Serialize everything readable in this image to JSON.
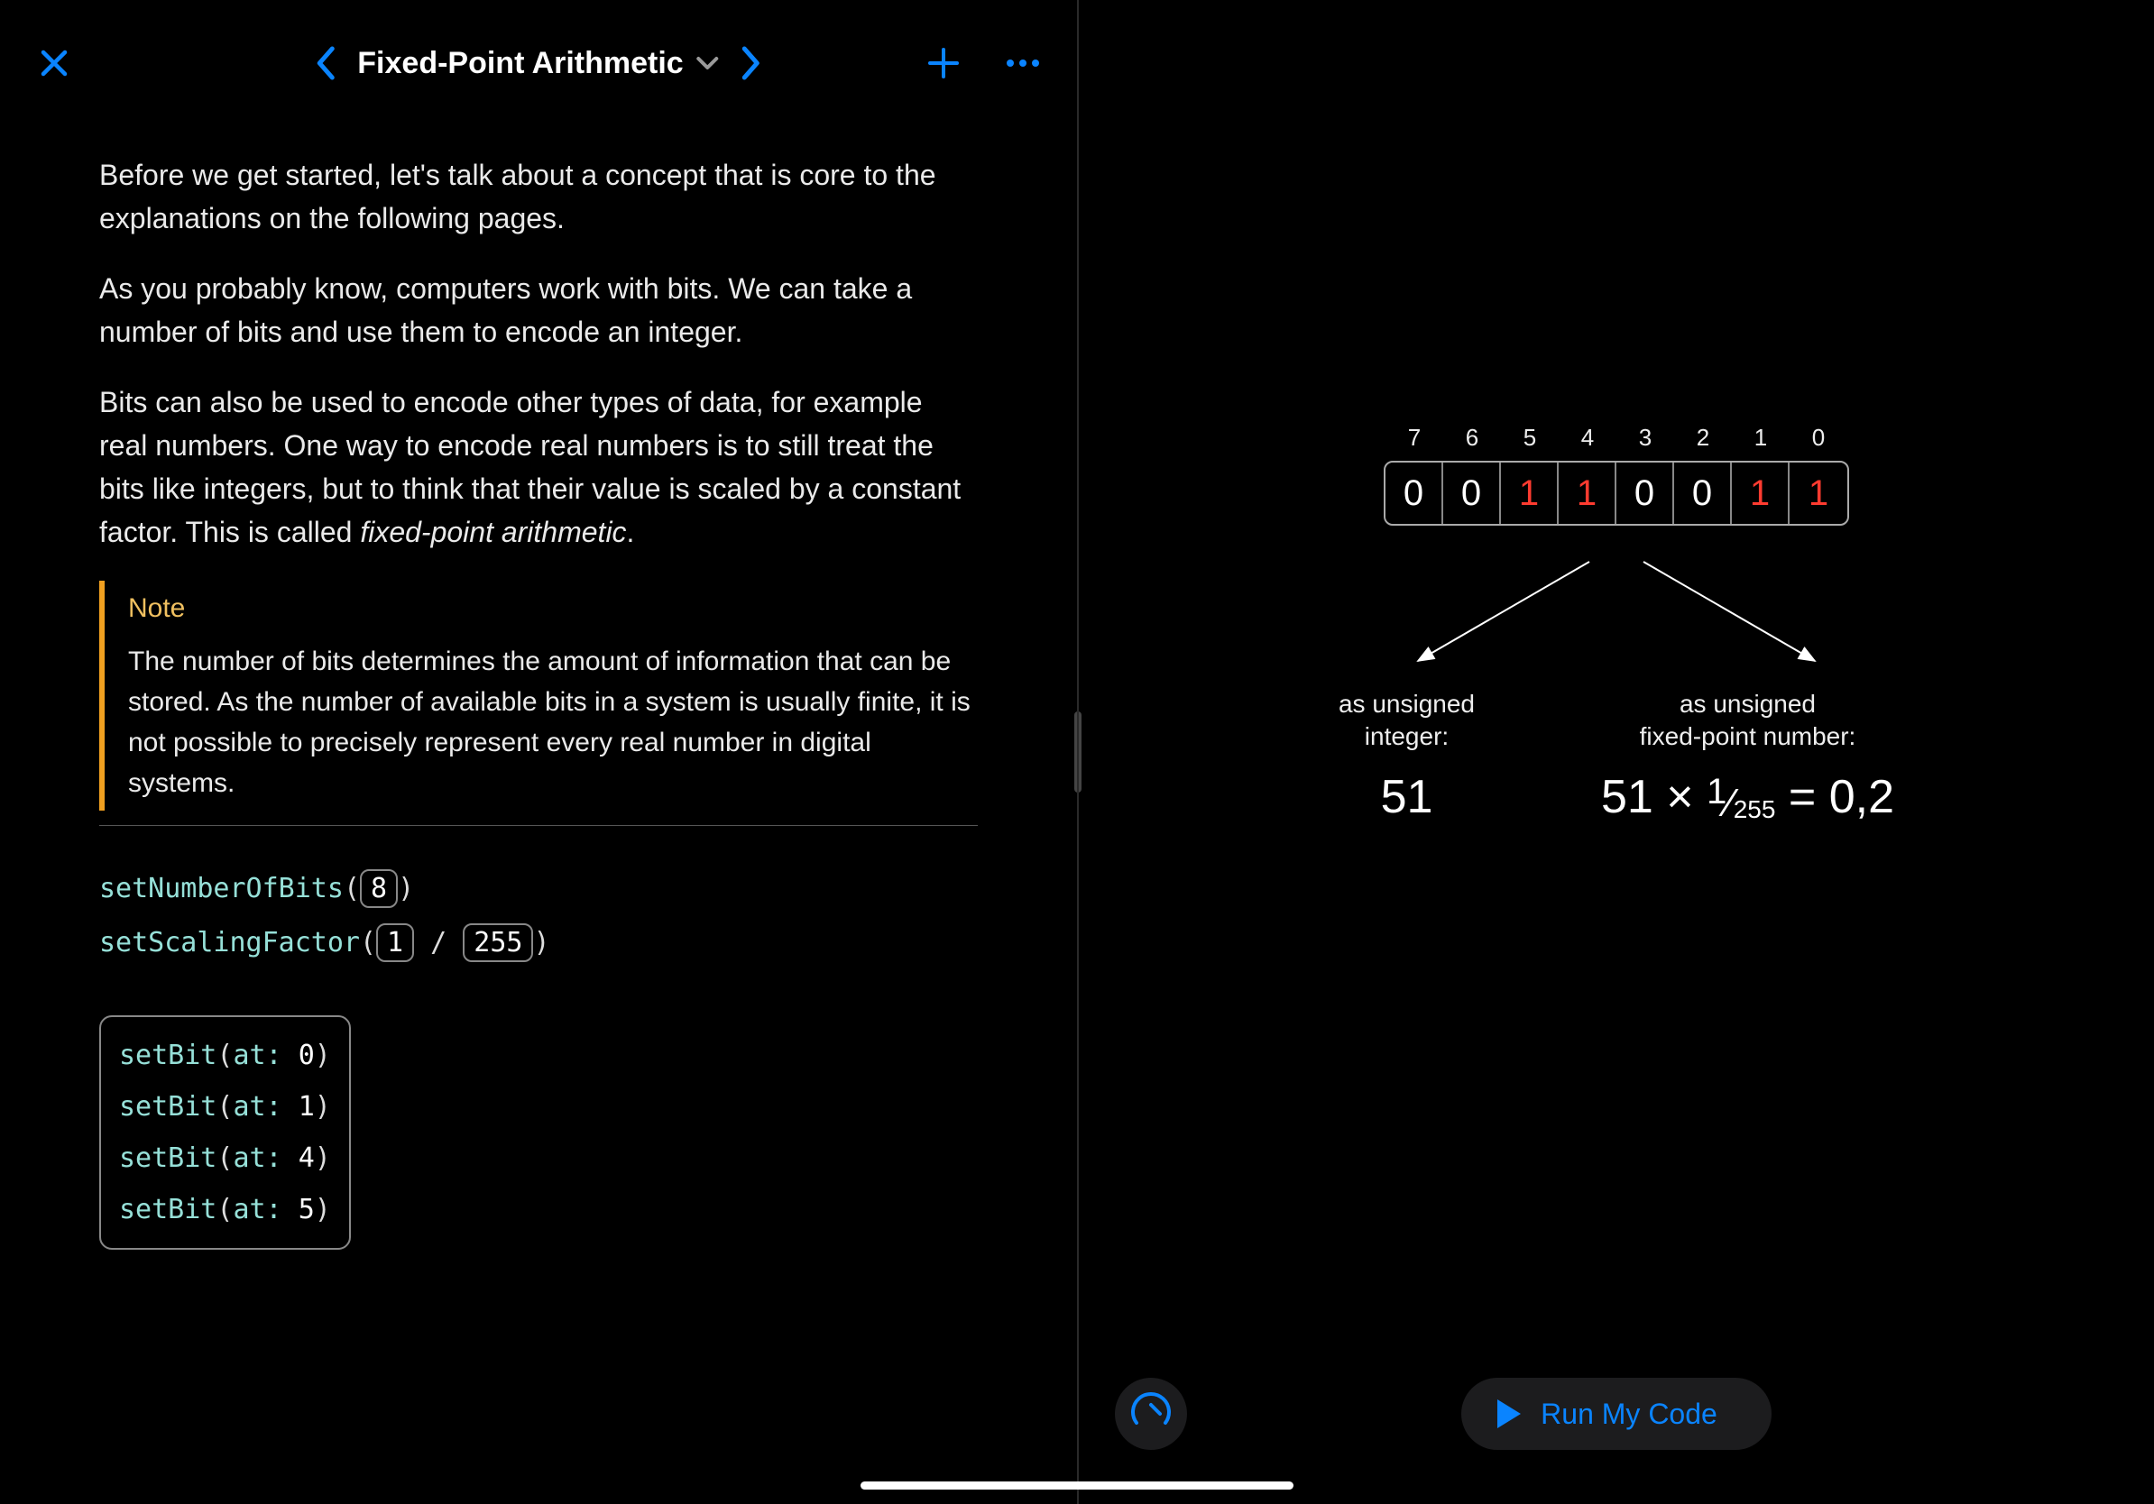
{
  "header": {
    "title": "Fixed-Point Arithmetic"
  },
  "text": {
    "p1": "Before we get started, let's talk about a concept that is core to the explanations on the following pages.",
    "p2": "As you probably know, computers work with bits. We can take a number of bits and use them to encode an integer.",
    "p3_a": "Bits can also be used to encode other types of data, for example real numbers. One way to encode real numbers is to still treat the bits like integers, but to think that their value is scaled by a constant factor. This is called ",
    "p3_b": "fixed-point arithmetic",
    "p3_c": ".",
    "note_title": "Note",
    "note_body": "The number of bits determines the amount of information that can be stored. As the number of available bits in a system is usually finite, it is not possible to precisely represent every real number in digital systems."
  },
  "code": {
    "fn1": "setNumberOfBits",
    "arg1": "8",
    "fn2": "setScalingFactor",
    "arg2a": "1",
    "divide": "/",
    "arg2b": "255",
    "block": {
      "fn": "setBit",
      "label": "at:",
      "lines": [
        "0",
        "1",
        "4",
        "5"
      ]
    }
  },
  "viz": {
    "indices": [
      "7",
      "6",
      "5",
      "4",
      "3",
      "2",
      "1",
      "0"
    ],
    "bits": [
      "0",
      "0",
      "1",
      "1",
      "0",
      "0",
      "1",
      "1"
    ],
    "bits_on": [
      false,
      false,
      true,
      true,
      false,
      false,
      true,
      true
    ],
    "left_label_l1": "as unsigned",
    "left_label_l2": "integer:",
    "left_value": "51",
    "right_label_l1": "as unsigned",
    "right_label_l2": "fixed-point number:",
    "right_expr_a": "51 × ",
    "right_expr_num": "1",
    "right_expr_den": "255",
    "right_expr_b": " = 0,2"
  },
  "run": {
    "label": "Run My Code"
  }
}
